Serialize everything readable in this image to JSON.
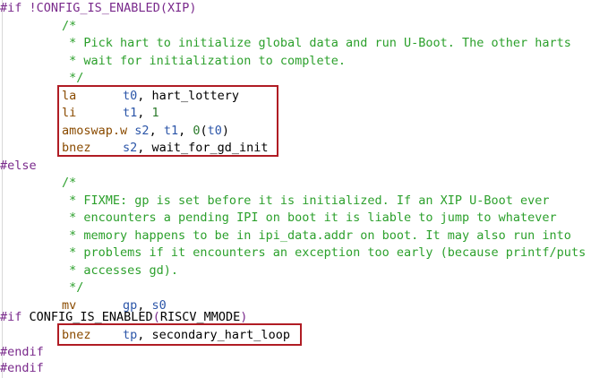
{
  "colors": {
    "preprocessor": "#7a2a8c",
    "comment": "#2ca02c",
    "mnemonic": "#8a4b00",
    "register": "#2b55a8",
    "number": "#2b7a2b",
    "highlight_box": "#b01c24"
  },
  "code": {
    "if_kw": "#if",
    "if_cond": " !CONFIG_IS_ENABLED(XIP)",
    "c1_open": "/*",
    "c1_l1": " * Pick hart to initialize global data and run U-Boot. The other harts",
    "c1_l2": " * wait for initialization to complete.",
    "c1_close": " */",
    "la_op": "la",
    "la_reg": "t0",
    "la_arg": ", hart_lottery",
    "li_op": "li",
    "li_reg": "t1",
    "li_sep": ", ",
    "li_num": "1",
    "amo_op": "amoswap.w",
    "amo_r1": "s2",
    "amo_s1": ", ",
    "amo_r2": "t1",
    "amo_s2": ", ",
    "amo_num": "0",
    "amo_p1": "(",
    "amo_r3": "t0",
    "amo_p2": ")",
    "bnez1_op": "bnez",
    "bnez1_reg": "s2",
    "bnez1_arg": ", wait_for_gd_init",
    "else_kw": "#else",
    "c2_open": "/*",
    "c2_l1": " * FIXME: gp is set before it is initialized. If an XIP U-Boot ever",
    "c2_l2": " * encounters a pending IPI on boot it is liable to jump to whatever",
    "c2_l3": " * memory happens to be in ipi_data.addr on boot. It may also run into",
    "c2_l4": " * problems if it encounters an exception too early (because printf/puts",
    "c2_l5": " * accesses gd).",
    "c2_close": " */",
    "mv_op": "mv",
    "mv_r1": "gp",
    "mv_sep": ", ",
    "mv_r2": "s0",
    "if2_kw": "#if",
    "if2_cond": " CONFIG_IS_ENABLED",
    "if2_p1": "(",
    "if2_arg": "RISCV_MMODE",
    "if2_p2": ")",
    "bnez2_op": "bnez",
    "bnez2_reg": "tp",
    "bnez2_arg": ", secondary_hart_loop",
    "endif1": "#endif",
    "endif2": "#endif"
  }
}
